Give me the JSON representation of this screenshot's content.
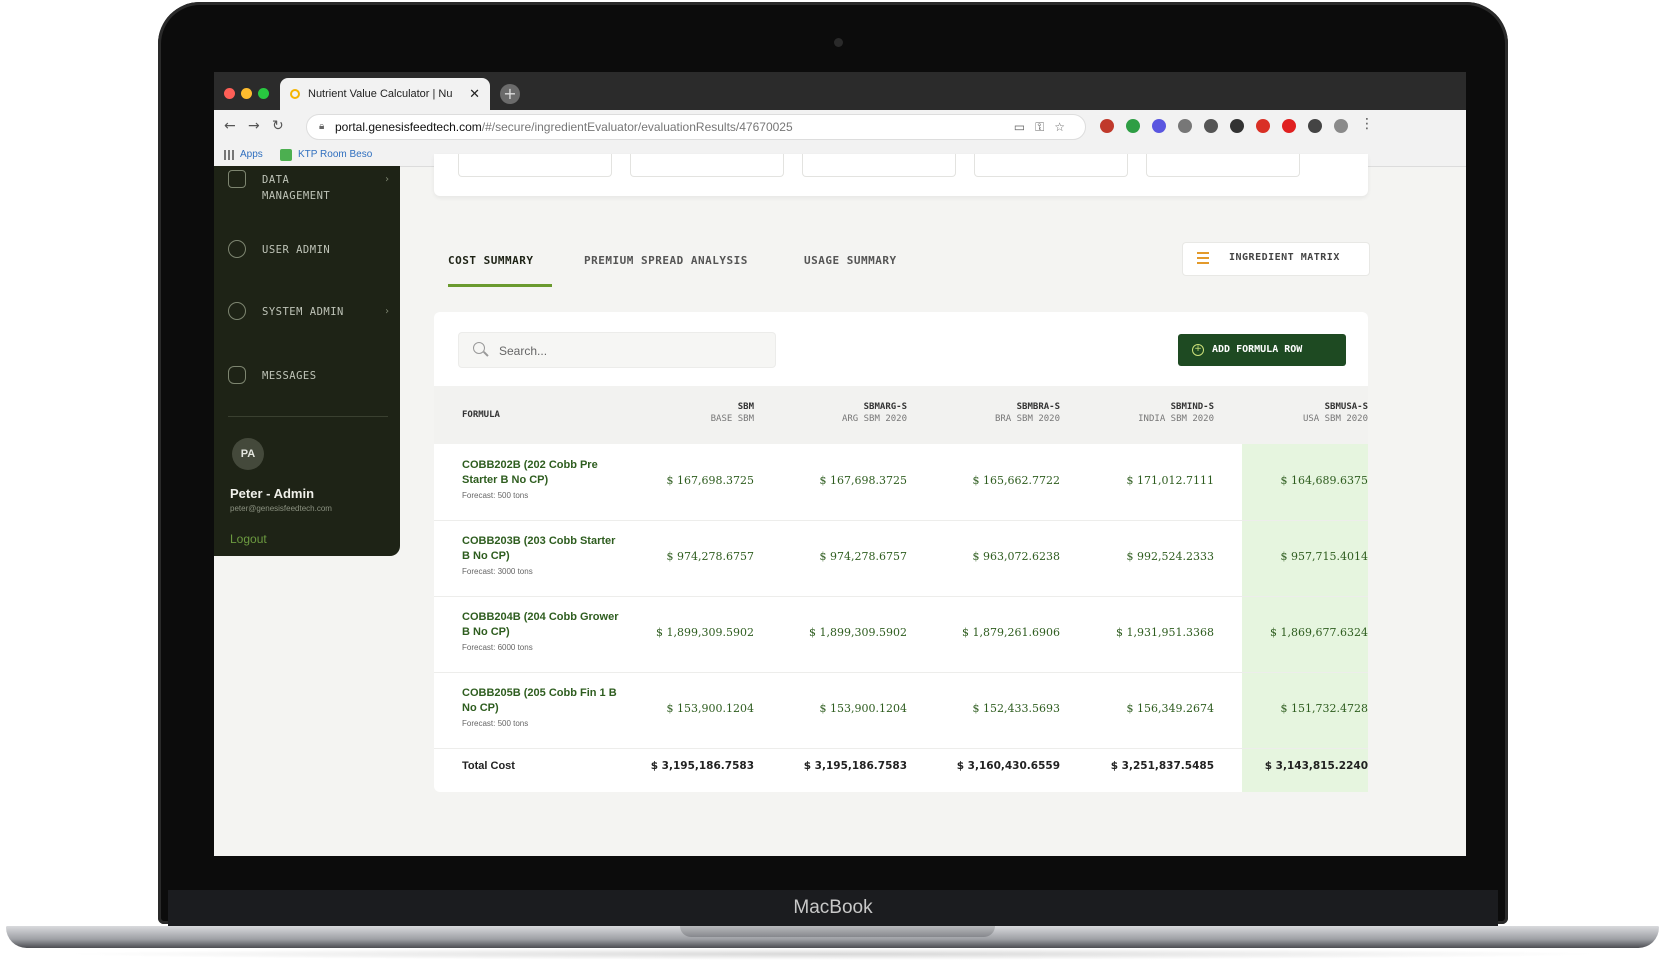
{
  "device_label": "MacBook",
  "browser": {
    "tab_title": "Nutrient Value Calculator | Nu",
    "url_host": "portal.genesisfeedtech.com",
    "url_path": "/#/secure/ingredientEvaluator/evaluationResults/47670025",
    "bookmarks": [
      "Apps",
      "KTP Room Beso"
    ]
  },
  "sidebar": {
    "items": [
      {
        "label": "DATA MANAGEMENT",
        "icon": "database-icon",
        "has_submenu": true
      },
      {
        "label": "USER ADMIN",
        "icon": "users-icon",
        "has_submenu": false
      },
      {
        "label": "SYSTEM ADMIN",
        "icon": "gear-icon",
        "has_submenu": true
      },
      {
        "label": "MESSAGES",
        "icon": "chat-icon",
        "has_submenu": false
      }
    ],
    "user": {
      "initials": "PA",
      "name": "Peter - Admin",
      "email": "peter@genesisfeedtech.com",
      "logout": "Logout"
    }
  },
  "tabs": [
    {
      "label": "COST SUMMARY",
      "active": true
    },
    {
      "label": "PREMIUM SPREAD ANALYSIS",
      "active": false
    },
    {
      "label": "USAGE SUMMARY",
      "active": false
    }
  ],
  "ingredient_matrix_label": "INGREDIENT MATRIX",
  "search": {
    "placeholder": "Search...",
    "value": ""
  },
  "add_formula_label": "ADD FORMULA ROW",
  "table": {
    "formula_header": "FORMULA",
    "columns": [
      {
        "code": "SBM",
        "sub": "BASE SBM"
      },
      {
        "code": "SBMARG-S",
        "sub": "ARG SBM 2020"
      },
      {
        "code": "SBMBRA-S",
        "sub": "BRA SBM 2020"
      },
      {
        "code": "SBMIND-S",
        "sub": "INDIA SBM 2020"
      },
      {
        "code": "SBMUSA-S",
        "sub": "USA SBM 2020"
      }
    ],
    "rows": [
      {
        "name": "COBB202B (202 Cobb Pre Starter B No CP)",
        "forecast": "Forecast: 500 tons",
        "values": [
          "$ 167,698.3725",
          "$ 167,698.3725",
          "$ 165,662.7722",
          "$ 171,012.7111",
          "$ 164,689.6375"
        ]
      },
      {
        "name": "COBB203B (203 Cobb Starter B No CP)",
        "forecast": "Forecast: 3000 tons",
        "values": [
          "$ 974,278.6757",
          "$ 974,278.6757",
          "$ 963,072.6238",
          "$ 992,524.2333",
          "$ 957,715.4014"
        ]
      },
      {
        "name": "COBB204B (204 Cobb Grower B No CP)",
        "forecast": "Forecast: 6000 tons",
        "values": [
          "$ 1,899,309.5902",
          "$ 1,899,309.5902",
          "$ 1,879,261.6906",
          "$ 1,931,951.3368",
          "$ 1,869,677.6324"
        ]
      },
      {
        "name": "COBB205B (205 Cobb Fin 1 B No CP)",
        "forecast": "Forecast: 500 tons",
        "values": [
          "$ 153,900.1204",
          "$ 153,900.1204",
          "$ 152,433.5693",
          "$ 156,349.2674",
          "$ 151,732.4728"
        ]
      }
    ],
    "total_label": "Total Cost",
    "totals": [
      "$ 3,195,186.7583",
      "$ 3,195,186.7583",
      "$ 3,160,430.6559",
      "$ 3,251,837.5485",
      "$ 3,143,815.2240"
    ]
  },
  "colors": {
    "sidebar_bg": "#1e2316",
    "accent_green": "#6a9a2f",
    "button_green": "#1e4a22",
    "highlight": "#e6f5df"
  }
}
